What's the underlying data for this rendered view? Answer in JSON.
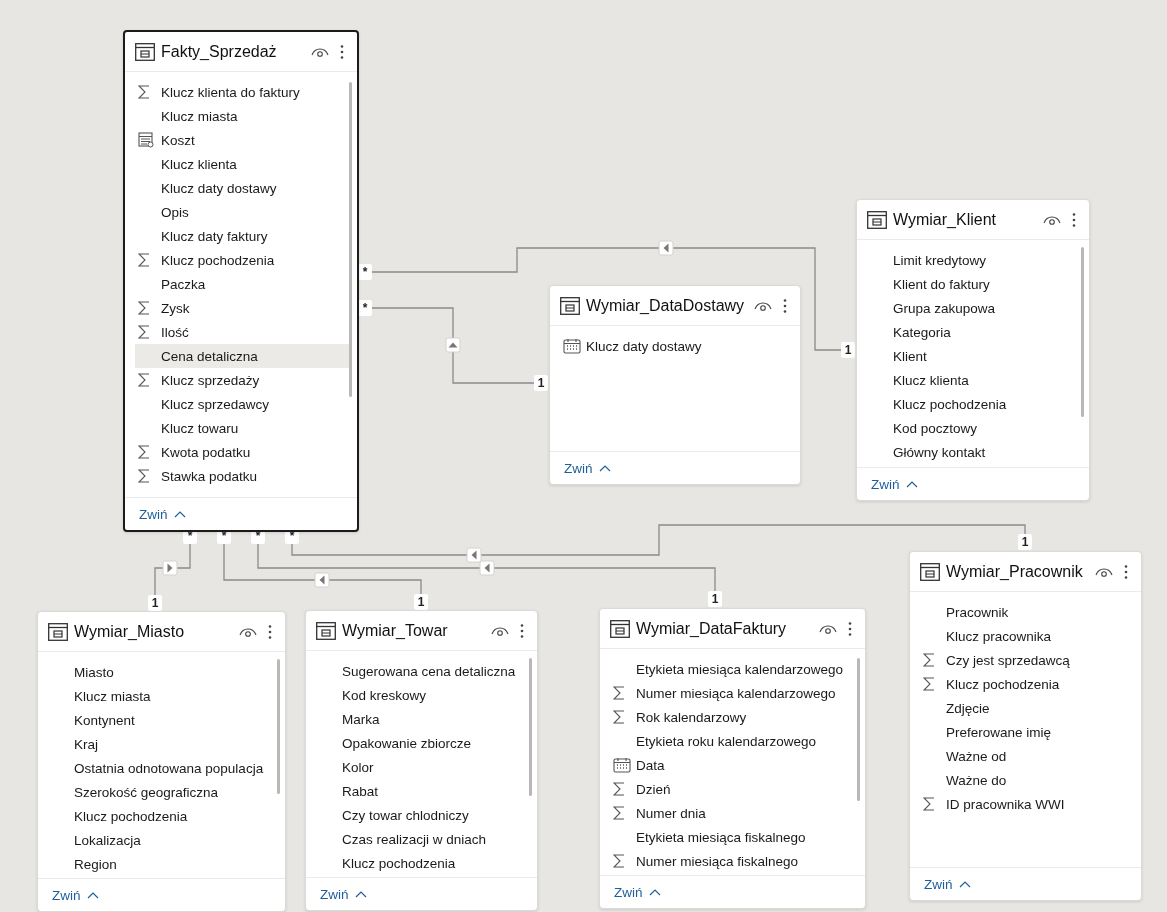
{
  "tables": [
    {
      "name": "Fakty_Sprzedaż",
      "selected": true,
      "collapse": "Zwiń",
      "fields": [
        {
          "name": "Klucz klienta do faktury",
          "kind": "sigma",
          "selected": false
        },
        {
          "name": "Klucz miasta",
          "kind": "plain",
          "selected": false
        },
        {
          "name": "Koszt",
          "kind": "calc",
          "selected": false
        },
        {
          "name": "Klucz klienta",
          "kind": "plain",
          "selected": false
        },
        {
          "name": "Klucz daty dostawy",
          "kind": "plain",
          "selected": false
        },
        {
          "name": "Opis",
          "kind": "plain",
          "selected": false
        },
        {
          "name": "Klucz daty faktury",
          "kind": "plain",
          "selected": false
        },
        {
          "name": "Klucz pochodzenia",
          "kind": "sigma",
          "selected": false
        },
        {
          "name": "Paczka",
          "kind": "plain",
          "selected": false
        },
        {
          "name": "Zysk",
          "kind": "sigma",
          "selected": false
        },
        {
          "name": "Ilość",
          "kind": "sigma",
          "selected": false
        },
        {
          "name": "Cena detaliczna",
          "kind": "plain",
          "selected": true
        },
        {
          "name": "Klucz sprzedaży",
          "kind": "sigma",
          "selected": false
        },
        {
          "name": "Klucz sprzedawcy",
          "kind": "plain",
          "selected": false
        },
        {
          "name": "Klucz towaru",
          "kind": "plain",
          "selected": false
        },
        {
          "name": "Kwota podatku",
          "kind": "sigma",
          "selected": false
        },
        {
          "name": "Stawka podatku",
          "kind": "sigma",
          "selected": false
        }
      ]
    },
    {
      "name": "Wymiar_DataDostawy",
      "selected": false,
      "collapse": "Zwiń",
      "fields": [
        {
          "name": "Klucz daty dostawy",
          "kind": "calendar",
          "selected": false
        }
      ]
    },
    {
      "name": "Wymiar_Klient",
      "selected": false,
      "collapse": "Zwiń",
      "fields": [
        {
          "name": "Limit kredytowy",
          "kind": "plain",
          "selected": false
        },
        {
          "name": "Klient do faktury",
          "kind": "plain",
          "selected": false
        },
        {
          "name": "Grupa zakupowa",
          "kind": "plain",
          "selected": false
        },
        {
          "name": "Kategoria",
          "kind": "plain",
          "selected": false
        },
        {
          "name": "Klient",
          "kind": "plain",
          "selected": false
        },
        {
          "name": "Klucz klienta",
          "kind": "plain",
          "selected": false
        },
        {
          "name": "Klucz pochodzenia",
          "kind": "plain",
          "selected": false
        },
        {
          "name": "Kod pocztowy",
          "kind": "plain",
          "selected": false
        },
        {
          "name": "Główny kontakt",
          "kind": "plain",
          "selected": false
        }
      ]
    },
    {
      "name": "Wymiar_Miasto",
      "selected": false,
      "collapse": "Zwiń",
      "fields": [
        {
          "name": "Miasto",
          "kind": "plain",
          "selected": false
        },
        {
          "name": "Klucz miasta",
          "kind": "plain",
          "selected": false
        },
        {
          "name": "Kontynent",
          "kind": "plain",
          "selected": false
        },
        {
          "name": "Kraj",
          "kind": "plain",
          "selected": false
        },
        {
          "name": "Ostatnia odnotowana populacja",
          "kind": "plain",
          "selected": false
        },
        {
          "name": "Szerokość geograficzna",
          "kind": "plain",
          "selected": false
        },
        {
          "name": "Klucz pochodzenia",
          "kind": "plain",
          "selected": false
        },
        {
          "name": "Lokalizacja",
          "kind": "plain",
          "selected": false
        },
        {
          "name": "Region",
          "kind": "plain",
          "selected": false
        }
      ]
    },
    {
      "name": "Wymiar_Towar",
      "selected": false,
      "collapse": "Zwiń",
      "fields": [
        {
          "name": "Sugerowana cena detaliczna",
          "kind": "plain",
          "selected": false
        },
        {
          "name": "Kod kreskowy",
          "kind": "plain",
          "selected": false
        },
        {
          "name": "Marka",
          "kind": "plain",
          "selected": false
        },
        {
          "name": "Opakowanie zbiorcze",
          "kind": "plain",
          "selected": false
        },
        {
          "name": "Kolor",
          "kind": "plain",
          "selected": false
        },
        {
          "name": "Rabat",
          "kind": "plain",
          "selected": false
        },
        {
          "name": "Czy towar chlodniczy",
          "kind": "plain",
          "selected": false
        },
        {
          "name": "Czas realizacji w dniach",
          "kind": "plain",
          "selected": false
        },
        {
          "name": "Klucz pochodzenia",
          "kind": "plain",
          "selected": false
        }
      ]
    },
    {
      "name": "Wymiar_DataFaktury",
      "selected": false,
      "collapse": "Zwiń",
      "fields": [
        {
          "name": "Etykieta miesiąca kalendarzowego",
          "kind": "plain",
          "selected": false
        },
        {
          "name": "Numer miesiąca kalendarzowego",
          "kind": "sigma",
          "selected": false
        },
        {
          "name": "Rok kalendarzowy",
          "kind": "sigma",
          "selected": false
        },
        {
          "name": "Etykieta roku kalendarzowego",
          "kind": "plain",
          "selected": false
        },
        {
          "name": "Data",
          "kind": "calendar",
          "selected": false
        },
        {
          "name": "Dzień",
          "kind": "sigma",
          "selected": false
        },
        {
          "name": "Numer dnia",
          "kind": "sigma",
          "selected": false
        },
        {
          "name": "Etykieta miesiąca fiskalnego",
          "kind": "plain",
          "selected": false
        },
        {
          "name": "Numer miesiąca fiskalnego",
          "kind": "sigma",
          "selected": false
        }
      ]
    },
    {
      "name": "Wymiar_Pracownik",
      "selected": false,
      "collapse": "Zwiń",
      "fields": [
        {
          "name": "Pracownik",
          "kind": "plain",
          "selected": false
        },
        {
          "name": "Klucz pracownika",
          "kind": "plain",
          "selected": false
        },
        {
          "name": "Czy jest sprzedawcą",
          "kind": "sigma",
          "selected": false
        },
        {
          "name": "Klucz pochodzenia",
          "kind": "sigma",
          "selected": false
        },
        {
          "name": "Zdjęcie",
          "kind": "plain",
          "selected": false
        },
        {
          "name": "Preferowane imię",
          "kind": "plain",
          "selected": false
        },
        {
          "name": "Ważne od",
          "kind": "plain",
          "selected": false
        },
        {
          "name": "Ważne do",
          "kind": "plain",
          "selected": false
        },
        {
          "name": "ID pracownika WWI",
          "kind": "sigma",
          "selected": false
        }
      ]
    }
  ],
  "relationships": [
    {
      "many_end": "*",
      "one_end": "1",
      "filter_arrow": true
    },
    {
      "many_end": "*",
      "one_end": "1",
      "filter_arrow": true
    },
    {
      "many_end": "*",
      "one_end": "1",
      "filter_arrow": true
    },
    {
      "many_end": "*",
      "one_end": "1",
      "filter_arrow": true
    },
    {
      "many_end": "*",
      "one_end": "1",
      "filter_arrow": true
    },
    {
      "many_end": "*",
      "one_end": "1",
      "filter_arrow": true
    }
  ]
}
